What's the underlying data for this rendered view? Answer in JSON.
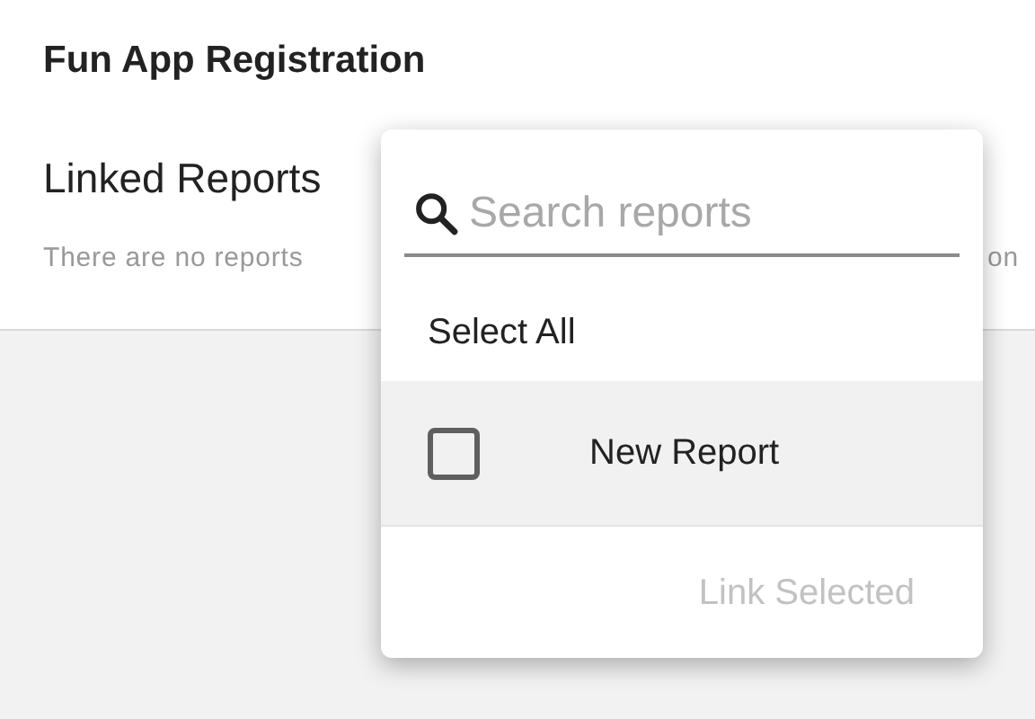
{
  "page": {
    "title": "Fun App Registration",
    "section_title": "Linked Reports",
    "empty_message_start": "There are no reports",
    "empty_message_end": "on"
  },
  "popup": {
    "search": {
      "placeholder": "Search reports"
    },
    "select_all": "Select All",
    "items": [
      {
        "label": "New Report",
        "checked": false,
        "highlighted": true
      }
    ],
    "action": {
      "label": "Link Selected",
      "disabled": true
    }
  }
}
